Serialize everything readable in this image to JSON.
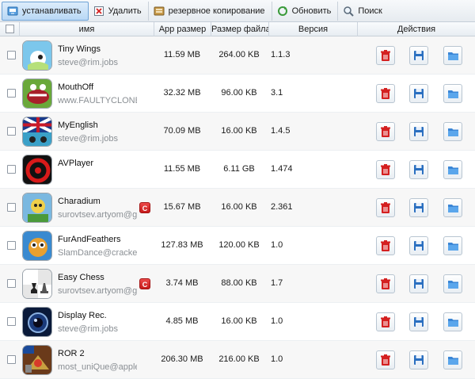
{
  "toolbar": {
    "install_label": "устанавливать",
    "delete_label": "Удалить",
    "backup_label": "резервное копирование",
    "refresh_label": "Обновить",
    "search_label": "Поиск"
  },
  "columns": {
    "name": "имя",
    "app_size": "App размер",
    "file_size": "Размер файла",
    "version": "Версия",
    "actions": "Действия"
  },
  "icons": {
    "delete": "trash-icon",
    "backup": "floppy-icon",
    "open": "folder-icon"
  },
  "colors": {
    "delete_red": "#d42020",
    "save_blue": "#2a6fc0",
    "folder_blue": "#3a86d6",
    "badge_red": "#d42020"
  },
  "apps": [
    {
      "name": "Tiny Wings",
      "author": "steve@rim.jobs",
      "badge": "",
      "app_size": "11.59 MB",
      "file_size": "264.00 KB",
      "version": "1.1.3"
    },
    {
      "name": "MouthOff",
      "author": "www.FAULTYCLONE.",
      "badge": "",
      "app_size": "32.32 MB",
      "file_size": "96.00 KB",
      "version": "3.1"
    },
    {
      "name": "MyEnglish",
      "author": "steve@rim.jobs",
      "badge": "",
      "app_size": "70.09 MB",
      "file_size": "16.00 KB",
      "version": "1.4.5"
    },
    {
      "name": "AVPlayer",
      "author": "",
      "badge": "",
      "app_size": "11.55 MB",
      "file_size": "6.11 GB",
      "version": "1.474"
    },
    {
      "name": "Charadium",
      "author": "surovtsev.artyom@g",
      "badge": "C",
      "app_size": "15.67 MB",
      "file_size": "16.00 KB",
      "version": "2.361"
    },
    {
      "name": "FurAndFeathers",
      "author": "SlamDance@cracked.",
      "badge": "",
      "app_size": "127.83 MB",
      "file_size": "120.00 KB",
      "version": "1.0"
    },
    {
      "name": "Easy Chess",
      "author": "surovtsev.artyom@g",
      "badge": "C",
      "app_size": "3.74 MB",
      "file_size": "88.00 KB",
      "version": "1.7"
    },
    {
      "name": "Display Rec.",
      "author": "steve@rim.jobs",
      "badge": "",
      "app_size": "4.85 MB",
      "file_size": "16.00 KB",
      "version": "1.0"
    },
    {
      "name": "ROR 2",
      "author": "most_uniQue@apple.",
      "badge": "",
      "app_size": "206.30 MB",
      "file_size": "216.00 KB",
      "version": "1.0"
    }
  ]
}
